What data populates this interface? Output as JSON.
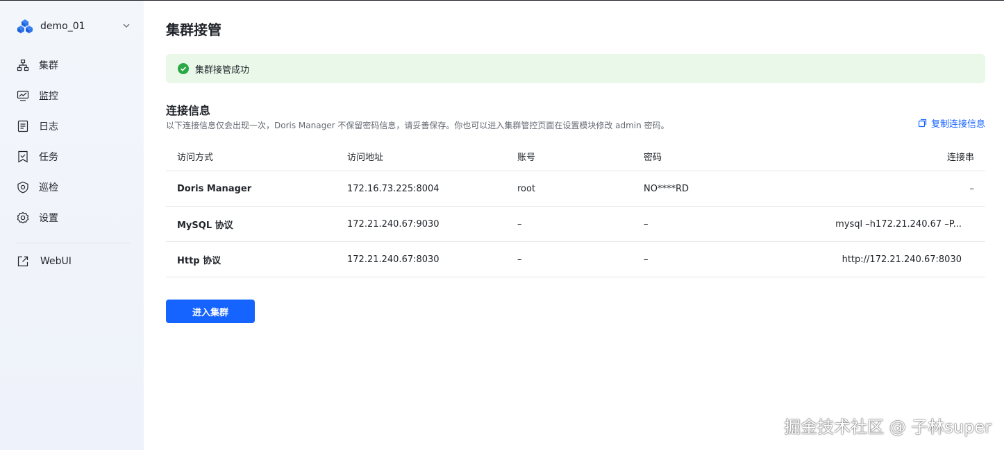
{
  "sidebar": {
    "cluster_name": "demo_01",
    "items": [
      {
        "label": "集群",
        "icon": "cluster-icon"
      },
      {
        "label": "监控",
        "icon": "monitor-icon"
      },
      {
        "label": "日志",
        "icon": "log-icon"
      },
      {
        "label": "任务",
        "icon": "task-icon"
      },
      {
        "label": "巡检",
        "icon": "inspection-icon"
      },
      {
        "label": "设置",
        "icon": "settings-icon"
      }
    ],
    "webui": {
      "label": "WebUI",
      "icon": "external-link-icon"
    }
  },
  "page": {
    "title": "集群接管",
    "alert": "集群接管成功",
    "section_title": "连接信息",
    "section_desc": "以下连接信息仅会出现一次，Doris Manager 不保留密码信息，请妥善保存。你也可以进入集群管控页面在设置模块修改 admin 密码。",
    "copy_label": "复制连接信息",
    "enter_button": "进入集群"
  },
  "table": {
    "headers": [
      "访问方式",
      "访问地址",
      "账号",
      "密码",
      "连接串"
    ],
    "rows": [
      [
        "Doris Manager",
        "172.16.73.225:8004",
        "root",
        "NO****RD",
        "–"
      ],
      [
        "MySQL 协议",
        "172.21.240.67:9030",
        "–",
        "–",
        "mysql –h172.21.240.67 –P..."
      ],
      [
        "Http 协议",
        "172.21.240.67:8030",
        "–",
        "–",
        "http://172.21.240.67:8030"
      ]
    ]
  },
  "colors": {
    "accent": "#1664ff",
    "success": "#2aa845",
    "alert_bg": "#eaf8ea"
  },
  "watermark": "掘金技术社区 @ 子林super"
}
